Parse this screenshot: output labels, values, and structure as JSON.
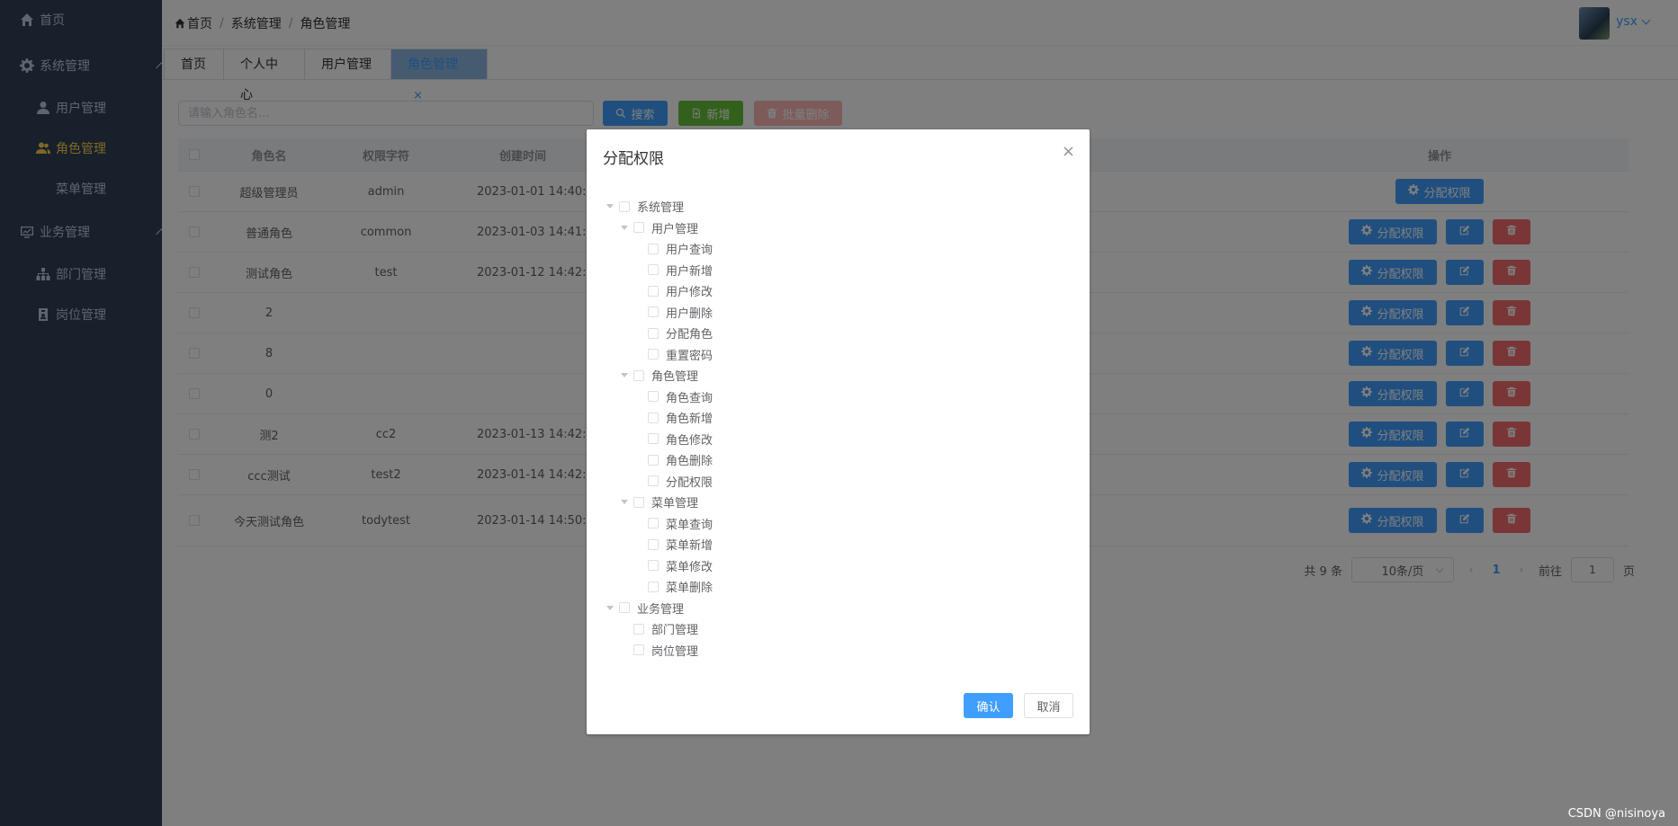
{
  "sidebar": {
    "items": [
      {
        "label": "首页",
        "icon": "home-icon"
      },
      {
        "label": "系统管理",
        "icon": "gear-icon"
      },
      {
        "label": "用户管理",
        "icon": "user-icon"
      },
      {
        "label": "角色管理",
        "icon": "users-icon"
      },
      {
        "label": "菜单管理",
        "icon": ""
      },
      {
        "label": "业务管理",
        "icon": "monitor-icon"
      },
      {
        "label": "部门管理",
        "icon": "org-icon"
      },
      {
        "label": "岗位管理",
        "icon": "badge-icon"
      }
    ],
    "bg": "#304156",
    "active_color": "#ffd04b"
  },
  "header": {
    "breadcrumb": [
      "首页",
      "系统管理",
      "角色管理"
    ],
    "username": "ysx"
  },
  "tabs": [
    {
      "label": "首页"
    },
    {
      "label": "个人中心"
    },
    {
      "label": "用户管理"
    },
    {
      "label": "角色管理",
      "close": "×"
    }
  ],
  "toolbar": {
    "search_placeholder": "请输入角色名...",
    "search_label": "搜索",
    "add_label": "新增",
    "batch_delete_label": "批量删除"
  },
  "table": {
    "columns": {
      "name": "角色名",
      "code": "权限字符",
      "created": "创建时间",
      "ops": "操作"
    },
    "rows": [
      {
        "name": "超级管理员",
        "code": "admin",
        "created": "2023-01-01 14:40:"
      },
      {
        "name": "普通角色",
        "code": "common",
        "created": "2023-01-03 14:41:"
      },
      {
        "name": "测试角色",
        "code": "test",
        "created": "2023-01-12 14:42:"
      },
      {
        "name": "2",
        "code": "",
        "created": ""
      },
      {
        "name": "8",
        "code": "",
        "created": ""
      },
      {
        "name": "0",
        "code": "",
        "created": ""
      },
      {
        "name": "测2",
        "code": "cc2",
        "created": "2023-01-13 14:42:"
      },
      {
        "name": "ccc测试",
        "code": "test2",
        "created": "2023-01-14 14:42:"
      },
      {
        "name": "今天测试角色",
        "code": "todytest",
        "created": "2023-01-14 14:50:"
      }
    ],
    "assign_label": "分配权限"
  },
  "pagination": {
    "total": "共 9 条",
    "page_size": "10条/页",
    "prev": "‹",
    "current": "1",
    "next": "›",
    "goto": "前往",
    "goto_value": "1",
    "page_unit": "页"
  },
  "dialog": {
    "title": "分配权限",
    "close": "×",
    "tree": [
      {
        "label": "系统管理",
        "level": 0,
        "expanded": true
      },
      {
        "label": "用户管理",
        "level": 1,
        "expanded": true
      },
      {
        "label": "用户查询",
        "level": 2
      },
      {
        "label": "用户新增",
        "level": 2
      },
      {
        "label": "用户修改",
        "level": 2
      },
      {
        "label": "用户删除",
        "level": 2
      },
      {
        "label": "分配角色",
        "level": 2
      },
      {
        "label": "重置密码",
        "level": 2
      },
      {
        "label": "角色管理",
        "level": 1,
        "expanded": true
      },
      {
        "label": "角色查询",
        "level": 2
      },
      {
        "label": "角色新增",
        "level": 2
      },
      {
        "label": "角色修改",
        "level": 2
      },
      {
        "label": "角色删除",
        "level": 2
      },
      {
        "label": "分配权限",
        "level": 2
      },
      {
        "label": "菜单管理",
        "level": 1,
        "expanded": true
      },
      {
        "label": "菜单查询",
        "level": 2
      },
      {
        "label": "菜单新增",
        "level": 2
      },
      {
        "label": "菜单修改",
        "level": 2
      },
      {
        "label": "菜单删除",
        "level": 2
      },
      {
        "label": "业务管理",
        "level": 0,
        "expanded": true
      },
      {
        "label": "部门管理",
        "level": 1
      },
      {
        "label": "岗位管理",
        "level": 1
      }
    ],
    "confirm_label": "确认",
    "cancel_label": "取消"
  },
  "watermark": "CSDN @nisinoya"
}
